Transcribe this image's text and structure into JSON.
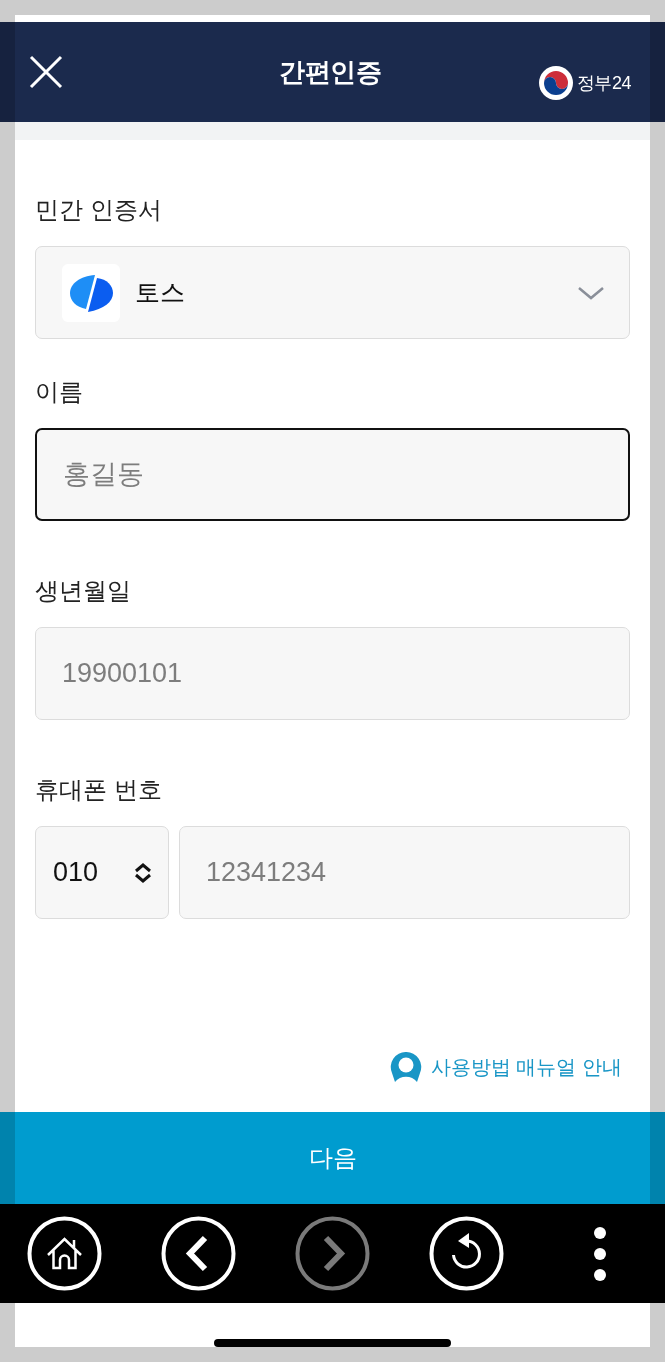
{
  "header": {
    "title": "간편인증",
    "logo_text": "정부24"
  },
  "certificate": {
    "label": "민간 인증서",
    "value": "토스"
  },
  "fields": [
    {
      "kind": "text",
      "label": "이름",
      "placeholder": "홍길동",
      "focused": true
    },
    {
      "kind": "text",
      "label": "생년월일",
      "placeholder": "19900101",
      "focused": false
    },
    {
      "kind": "phone",
      "label": "휴대폰 번호",
      "prefix": "010",
      "placeholder": "12341234",
      "focused": false
    }
  ],
  "manual_link": "사용방법 매뉴얼 안내",
  "next_button": "다음",
  "nav_bar": [
    {
      "kind": "home",
      "disabled": false
    },
    {
      "kind": "back",
      "disabled": false
    },
    {
      "kind": "forward",
      "disabled": true
    },
    {
      "kind": "refresh",
      "disabled": false
    },
    {
      "kind": "more",
      "disabled": false
    }
  ]
}
